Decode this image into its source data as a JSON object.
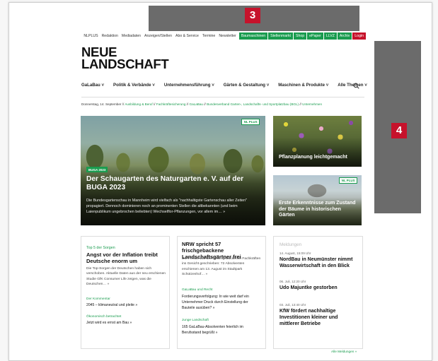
{
  "topnav": {
    "links": [
      "NLPLUS",
      "Redaktion",
      "Mediadaten",
      "Anzeigen/Stellen",
      "Abo & Service",
      "Termine",
      "Newsletter"
    ],
    "green_links": [
      "Baumaschinen",
      "Stellenmarkt",
      "Shop",
      "ePaper",
      "LLVZ",
      "Archiv"
    ],
    "login": "Login"
  },
  "ads": {
    "top_badge": "3",
    "side_badge": "4"
  },
  "logo": {
    "line1": "NEUE",
    "line2": "LANDSCHAFT"
  },
  "mainnav": {
    "items": [
      "GaLaBau",
      "Politik & Verbände",
      "Unternehmensführung",
      "Gärten & Gestaltung",
      "Maschinen & Produkte",
      "Alle Themen"
    ],
    "caret": "˅"
  },
  "breadcrumb": {
    "date": "Donnerstag, 14. September",
    "sep": "//",
    "items": [
      "Ausbildung & Beruf",
      "Fachkräftesicherung",
      "GaLaBau",
      "Bundesverband Garten-, Landschafts- und Sportplatzbau (BGL)",
      "Unternehmen"
    ]
  },
  "hero": {
    "badge": "NL PLUS",
    "tag": "BUGA 2023",
    "title": "Der Schaugarten des Naturgarten e. V. auf der BUGA 2023",
    "desc": "Die Bundesgartenschau in Mannheim wird vielfach als \"nachhaltigste Gartenschau aller Zeiten\" propagiert. Dennoch dominieren noch an prominenten Stellen die altbekannten (und beim Laienpublikum ungebrochen beliebten) Wechselflor-Pflanzungen, vor allem im… »"
  },
  "side_cards": [
    {
      "title": "Pflanzplanung leichtgemacht"
    },
    {
      "badge": "NL PLUS",
      "title": "Erste Erkenntnisse zum Zustand der Bäume in historischen Gärten"
    }
  ],
  "col1": {
    "kicker": "Top 5 der Sorgen",
    "headline": "Angst vor der Inflation treibt Deutsche enorm um",
    "text": "Die Top-Sorgen der Deutschen haben sich verschoben. Aktuelle Daten aus der neu erschienen Studie GfK Consumer Life zeigen, was die Deutschen… »",
    "links": [
      {
        "kicker": "Der Kommentar",
        "text": "2045 – klimaneutral und pleite »"
      },
      {
        "kicker": "Ökonomisch betrachtet",
        "text": "Jetzt wird es ernst am Bau »"
      }
    ]
  },
  "col2": {
    "headline": "NRW spricht 57 frischgebackene Landschaftsgärtner frei",
    "text": "Die Freude war den frisch gebackenen Fachkräften ins Gesicht geschrieben: 72 Absolventen erschienen am 13. August im Stadtpark Schützenhof… »",
    "links": [
      {
        "kicker": "GaLaBau und Recht",
        "text": "Forderungsverfolgung: In wie weit darf ein Unternehmer Druck durch Einstellung der Bauteile ausüben? »"
      },
      {
        "kicker": "Junge Landschaft",
        "text": "165 GaLaBau-Absolventen feierlich im Berufsstand begrüßt »"
      }
    ]
  },
  "col3": {
    "heading": "Meldungen",
    "items": [
      {
        "time": "14. August, 15:09 Uhr",
        "title": "NordBau in Neumünster nimmt Wasserwirtschaft in den Blick"
      },
      {
        "time": "06. Juli, 12:20 Uhr",
        "title": "Udo Majuntke gestorben"
      },
      {
        "time": "03. Juli, 13:40 Uhr",
        "title": "KfW fördert nachhaltige Investitionen kleiner und mittlerer Betriebe"
      }
    ],
    "all_link": "Alle Meldungen »"
  },
  "colors": {
    "green": "#1a9c4f",
    "red": "#c6122b",
    "ad_gray": "#6b6b6b"
  }
}
